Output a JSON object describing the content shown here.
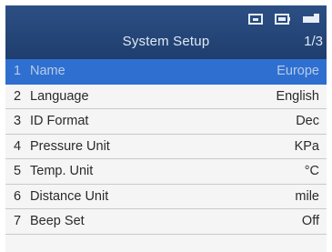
{
  "header": {
    "title": "System Setup",
    "page": "1/3",
    "icons": [
      "usb-icon",
      "battery-icon",
      "signal-icon"
    ]
  },
  "menu": [
    {
      "num": "1",
      "label": "Name",
      "value": "Europe"
    },
    {
      "num": "2",
      "label": "Language",
      "value": "English"
    },
    {
      "num": "3",
      "label": "ID Format",
      "value": "Dec"
    },
    {
      "num": "4",
      "label": "Pressure Unit",
      "value": "KPa"
    },
    {
      "num": "5",
      "label": "Temp. Unit",
      "value": "°C"
    },
    {
      "num": "6",
      "label": "Distance Unit",
      "value": "mile"
    },
    {
      "num": "7",
      "label": "Beep Set",
      "value": "Off"
    }
  ],
  "colors": {
    "header": "#24457a",
    "selected": "#2f6fd0",
    "background": "#f4f5f4"
  }
}
